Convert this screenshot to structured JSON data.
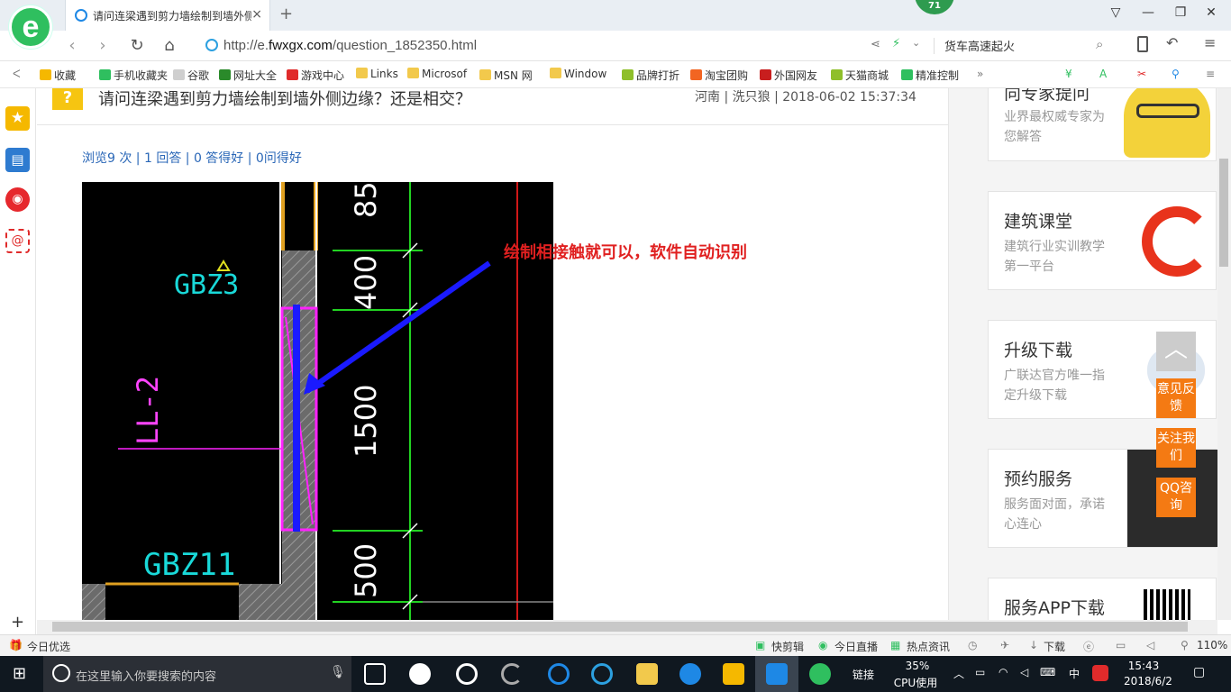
{
  "browser": {
    "tab_title": "请问连梁遇到剪力墙绘制到墙外侧",
    "url_prefix": "http://e.",
    "url_domain": "fwxgx.com",
    "url_path": "/question_1852350.html",
    "search_text": "货车高速起火",
    "badge_count": "71",
    "new_tab": "+",
    "close_tab": "×"
  },
  "bookmarks": [
    {
      "label": "收藏",
      "color": "#f5b800"
    },
    {
      "label": "手机收藏夹",
      "color": "#2fbf5f"
    },
    {
      "label": "谷歌",
      "color": "#cfcfcf"
    },
    {
      "label": "网址大全",
      "color": "#2a8a2a"
    },
    {
      "label": "游戏中心",
      "color": "#e02b2b"
    },
    {
      "label": "Links",
      "color": "#f2c94c"
    },
    {
      "label": "Microsof",
      "color": "#f2c94c"
    },
    {
      "label": "MSN 网",
      "color": "#f2c94c"
    },
    {
      "label": "Window",
      "color": "#f2c94c"
    },
    {
      "label": "品牌打折",
      "color": "#8fbf2a"
    },
    {
      "label": "淘宝团购",
      "color": "#f26522"
    },
    {
      "label": "外国网友",
      "color": "#c81e1e"
    },
    {
      "label": "天猫商城",
      "color": "#8fbf2a"
    },
    {
      "label": "精准控制",
      "color": "#2fbf5f"
    }
  ],
  "question": {
    "icon": "?",
    "title": "请问连梁遇到剪力墙绘制到墙外侧边缘？还是相交？",
    "meta": "河南 | 洗只狼 | 2018-06-02 15:37:34",
    "stats": "浏览9 次 | 1 回答 | 0 答得好 | 0问得好",
    "annotation": "绘制相接触就可以，软件自动识别"
  },
  "cad": {
    "labels": [
      "GBZ3",
      "GBZ11",
      "LL-2"
    ],
    "dims": [
      "85",
      "400",
      "1500",
      "500"
    ]
  },
  "sidebar_cards": [
    {
      "title": "向专家提问",
      "sub": "业界最权威专家为您解答"
    },
    {
      "title": "建筑课堂",
      "sub": "建筑行业实训教学第一平台"
    },
    {
      "title": "升级下载",
      "sub": "广联达官方唯一指定升级下载"
    },
    {
      "title": "预约服务",
      "sub": "服务面对面，承诺心连心"
    },
    {
      "title": "服务APP下载",
      "sub": ""
    }
  ],
  "float_buttons": [
    "意见反馈",
    "关注我们",
    "QQ咨询"
  ],
  "statusbar": {
    "left": "今日优选",
    "items": [
      "快剪辑",
      "今日直播",
      "热点资讯",
      "下载"
    ],
    "zoom": "110%"
  },
  "taskbar": {
    "search_placeholder": "在这里输入你要搜索的内容",
    "link_label": "链接",
    "cpu_percent": "35%",
    "cpu_label": "CPU使用",
    "ime": "中",
    "time": "15:43",
    "date": "2018/6/2"
  },
  "colors": {
    "accent": "#2fbf5f",
    "link": "#2a67b7",
    "annotation": "#e02020",
    "float": "#f47a13"
  }
}
